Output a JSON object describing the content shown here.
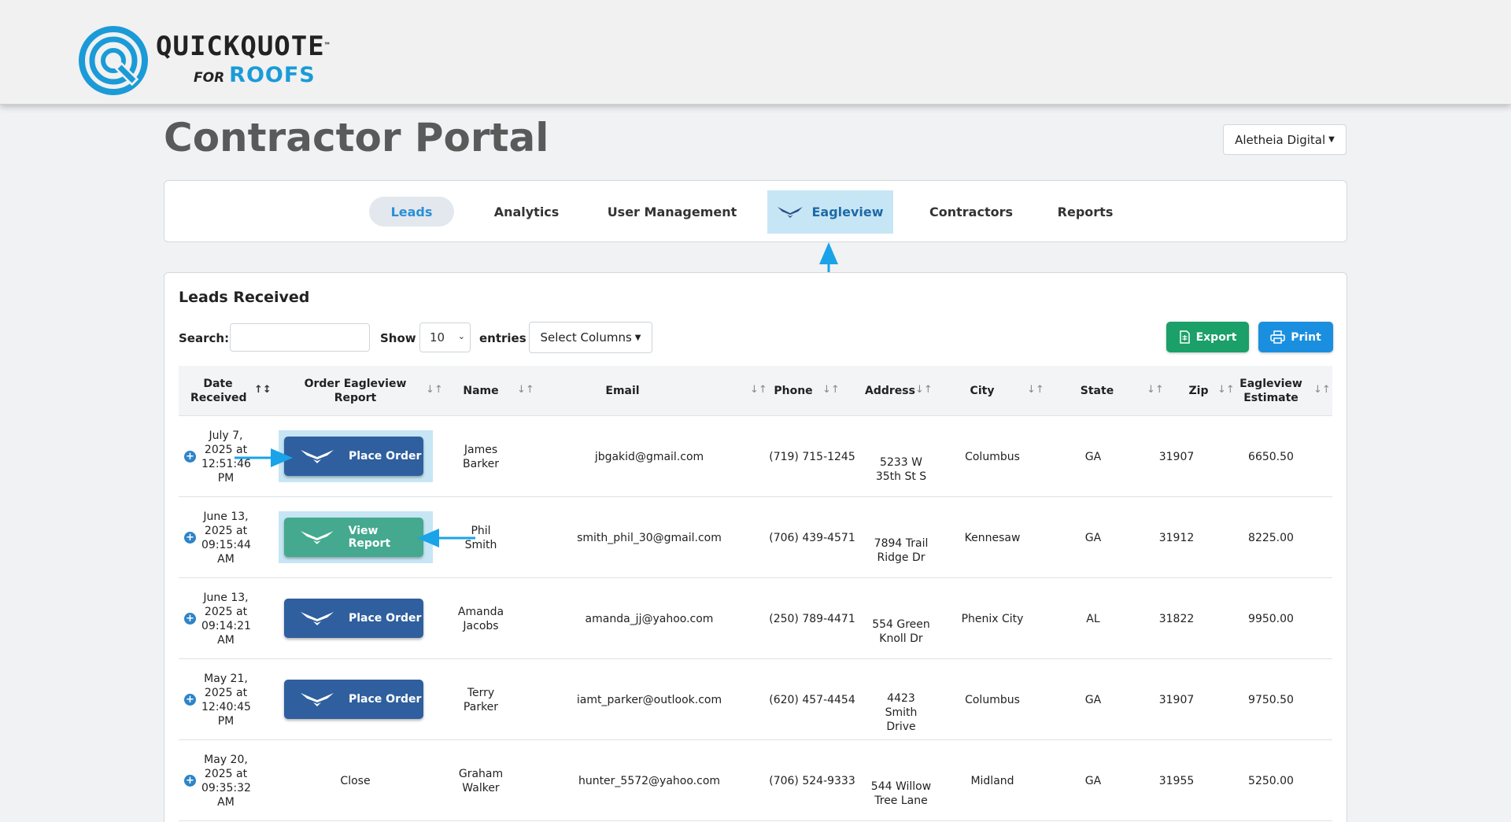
{
  "app": {
    "logo_line1": "QUICKQUOTE",
    "logo_tm": "™",
    "logo_for": "FOR",
    "logo_roofs": "ROOFS",
    "logo_badge_letter": "Q",
    "brand_color": "#1a9bd7"
  },
  "header": {
    "title": "Contractor Portal",
    "org_selector": "Aletheia Digital"
  },
  "nav": {
    "tabs": [
      {
        "label": "Leads",
        "active": true
      },
      {
        "label": "Analytics"
      },
      {
        "label": "User Management"
      },
      {
        "label": "Eagleview",
        "icon": "eagleview-logo-icon",
        "highlighted": true
      },
      {
        "label": "Contractors"
      },
      {
        "label": "Reports"
      }
    ]
  },
  "leads": {
    "title": "Leads Received",
    "search_label": "Search:",
    "search_value": "",
    "show_label": "Show",
    "show_value": "10",
    "entries_label": "entries",
    "columns_button": "Select Columns",
    "export_button": "Export",
    "print_button": "Print",
    "columns": [
      "Date Received",
      "Order Eagleview Report",
      "Name",
      "Email",
      "Phone",
      "Address",
      "City",
      "State",
      "Zip",
      "Eagleview Estimate"
    ],
    "rows": [
      {
        "date": "July 7, 2025 at 12:51:46 PM",
        "action": "Place Order",
        "action_type": "order",
        "name": "James Barker",
        "email": "jbgakid@gmail.com",
        "phone": "(719) 715-1245",
        "address": "5233 W 35th St S",
        "city": "Columbus",
        "state": "GA",
        "zip": "31907",
        "estimate": "6650.50"
      },
      {
        "date": "June 13, 2025 at 09:15:44 AM",
        "action": "View Report",
        "action_type": "report",
        "name": "Phil Smith",
        "email": "smith_phil_30@gmail.com",
        "phone": "(706) 439-4571",
        "address": "7894 Trail Ridge Dr",
        "city": "Kennesaw",
        "state": "GA",
        "zip": "31912",
        "estimate": "8225.00"
      },
      {
        "date": "June 13, 2025 at 09:14:21 AM",
        "action": "Place Order",
        "action_type": "order",
        "name": "Amanda Jacobs",
        "email": "amanda_jj@yahoo.com",
        "phone": "(250) 789-4471",
        "address": "554 Green Knoll Dr",
        "city": "Phenix City",
        "state": "AL",
        "zip": "31822",
        "estimate": "9950.00"
      },
      {
        "date": "May 21, 2025 at 12:40:45 PM",
        "action": "Place Order",
        "action_type": "order",
        "name": "Terry Parker",
        "email": "iamt_parker@outlook.com",
        "phone": "(620) 457-4454",
        "address": "4423 Smith Drive",
        "city": "Columbus",
        "state": "GA",
        "zip": "31907",
        "estimate": "9750.50"
      },
      {
        "date": "May 20, 2025 at 09:35:32 AM",
        "action": "Close",
        "action_type": "text",
        "name": "Graham Walker",
        "email": "hunter_5572@yahoo.com",
        "phone": "(706) 524-9333",
        "address": "544 Willow Tree Lane",
        "city": "Midland",
        "state": "GA",
        "zip": "31955",
        "estimate": "5250.00"
      }
    ]
  },
  "colors": {
    "tab_active_text": "#2b8fd6",
    "eagleview_highlight": "#c7e6f5",
    "place_order_button": "#2f5f9e",
    "view_report_button": "#44a98e",
    "export_button": "#1aa068",
    "print_button": "#1a8fe0",
    "callout_arrow": "#1aa3e8"
  }
}
